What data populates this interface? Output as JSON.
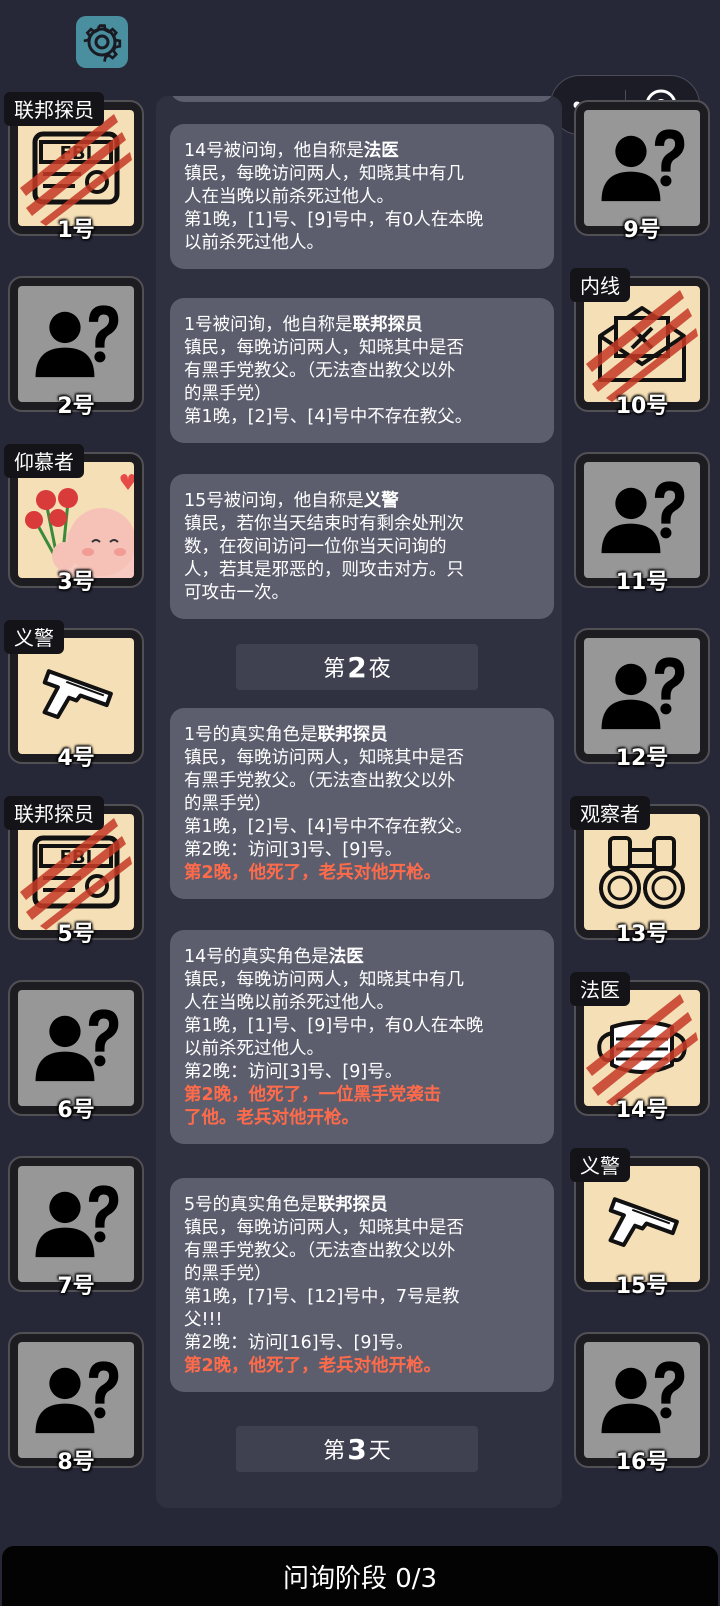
{
  "icons": {
    "settings": "gear-icon",
    "more": "more-dots-icon",
    "close": "close-circle-icon",
    "unknown": "person-question-icon"
  },
  "colors": {
    "background": "#262838",
    "kill_text": "#ff6b4a",
    "known_card": "#f5dfb6",
    "unknown_card": "#979797"
  },
  "players": [
    {
      "num": "1号",
      "tag": "联邦探员",
      "icon": "fbi-badge-icon",
      "dead": true
    },
    {
      "num": "2号",
      "tag": "",
      "icon": "unknown",
      "dead": false
    },
    {
      "num": "3号",
      "tag": "仰慕者",
      "icon": "admirer-roses-icon",
      "dead": false
    },
    {
      "num": "4号",
      "tag": "义警",
      "icon": "pistol-icon",
      "dead": false
    },
    {
      "num": "5号",
      "tag": "联邦探员",
      "icon": "fbi-badge-icon",
      "dead": true
    },
    {
      "num": "6号",
      "tag": "",
      "icon": "unknown",
      "dead": false
    },
    {
      "num": "7号",
      "tag": "",
      "icon": "unknown",
      "dead": false
    },
    {
      "num": "8号",
      "tag": "",
      "icon": "unknown",
      "dead": false
    },
    {
      "num": "9号",
      "tag": "",
      "icon": "unknown",
      "dead": false
    },
    {
      "num": "10号",
      "tag": "内线",
      "icon": "envelope-icon",
      "dead": true
    },
    {
      "num": "11号",
      "tag": "",
      "icon": "unknown",
      "dead": false
    },
    {
      "num": "12号",
      "tag": "",
      "icon": "unknown",
      "dead": false
    },
    {
      "num": "13号",
      "tag": "观察者",
      "icon": "binoculars-icon",
      "dead": false
    },
    {
      "num": "14号",
      "tag": "法医",
      "icon": "mask-icon",
      "dead": true
    },
    {
      "num": "15号",
      "tag": "义警",
      "icon": "pistol-icon",
      "dead": false
    },
    {
      "num": "16号",
      "tag": "",
      "icon": "unknown",
      "dead": false
    }
  ],
  "log": {
    "m1": {
      "l1a": "14号被问询，他自称是",
      "l1b": "法医",
      "l2": "镇民，每晚访问两人，知晓其中有几",
      "l3": "人在当晚以前杀死过他人。",
      "l4": "第1晚，[1]号、[9]号中，有0人在本晚",
      "l5": "以前杀死过他人。"
    },
    "m2": {
      "l1a": "1号被问询，他自称是",
      "l1b": "联邦探员",
      "l2": "镇民，每晚访问两人，知晓其中是否",
      "l3": "有黑手党教父。（无法查出教父以外",
      "l4": "的黑手党）",
      "l5": "第1晚，[2]号、[4]号中不存在教父。"
    },
    "m3": {
      "l1a": "15号被问询，他自称是",
      "l1b": "义警",
      "l2": "镇民，若你当天结束时有剩余处刑次",
      "l3": "数，在夜间访问一位你当天问询的",
      "l4": "人，若其是邪恶的，则攻击对方。只",
      "l5": "可攻击一次。"
    },
    "div1": {
      "pre": "第",
      "num": "2",
      "post": "夜"
    },
    "m4": {
      "l1a": "1号的真实角色是",
      "l1b": "联邦探员",
      "l2": "镇民，每晚访问两人，知晓其中是否",
      "l3": "有黑手党教父。（无法查出教父以外",
      "l4": "的黑手党）",
      "l5": "第1晚，[2]号、[4]号中不存在教父。",
      "l6": "第2晚：访问[3]号、[9]号。",
      "l7": "第2晚，他死了，老兵对他开枪。"
    },
    "m5": {
      "l1a": "14号的真实角色是",
      "l1b": "法医",
      "l2": "镇民，每晚访问两人，知晓其中有几",
      "l3": "人在当晚以前杀死过他人。",
      "l4": "第1晚，[1]号、[9]号中，有0人在本晚",
      "l5": "以前杀死过他人。",
      "l6": "第2晚：访问[3]号、[9]号。",
      "l7": "第2晚，他死了，一位黑手党袭击",
      "l8": "了他。老兵对他开枪。"
    },
    "m6": {
      "l1a": "5号的真实角色是",
      "l1b": "联邦探员",
      "l2": "镇民，每晚访问两人，知晓其中是否",
      "l3": "有黑手党教父。（无法查出教父以外",
      "l4": "的黑手党）",
      "l5": "第1晚，[7]号、[12]号中，7号是教",
      "l6": "父!!!",
      "l7": "第2晚：访问[16]号、[9]号。",
      "l8": "第2晚，他死了，老兵对他开枪。"
    },
    "div2": {
      "pre": "第",
      "num": "3",
      "post": "天"
    }
  },
  "status": {
    "phase": "问询阶段 0/3"
  }
}
